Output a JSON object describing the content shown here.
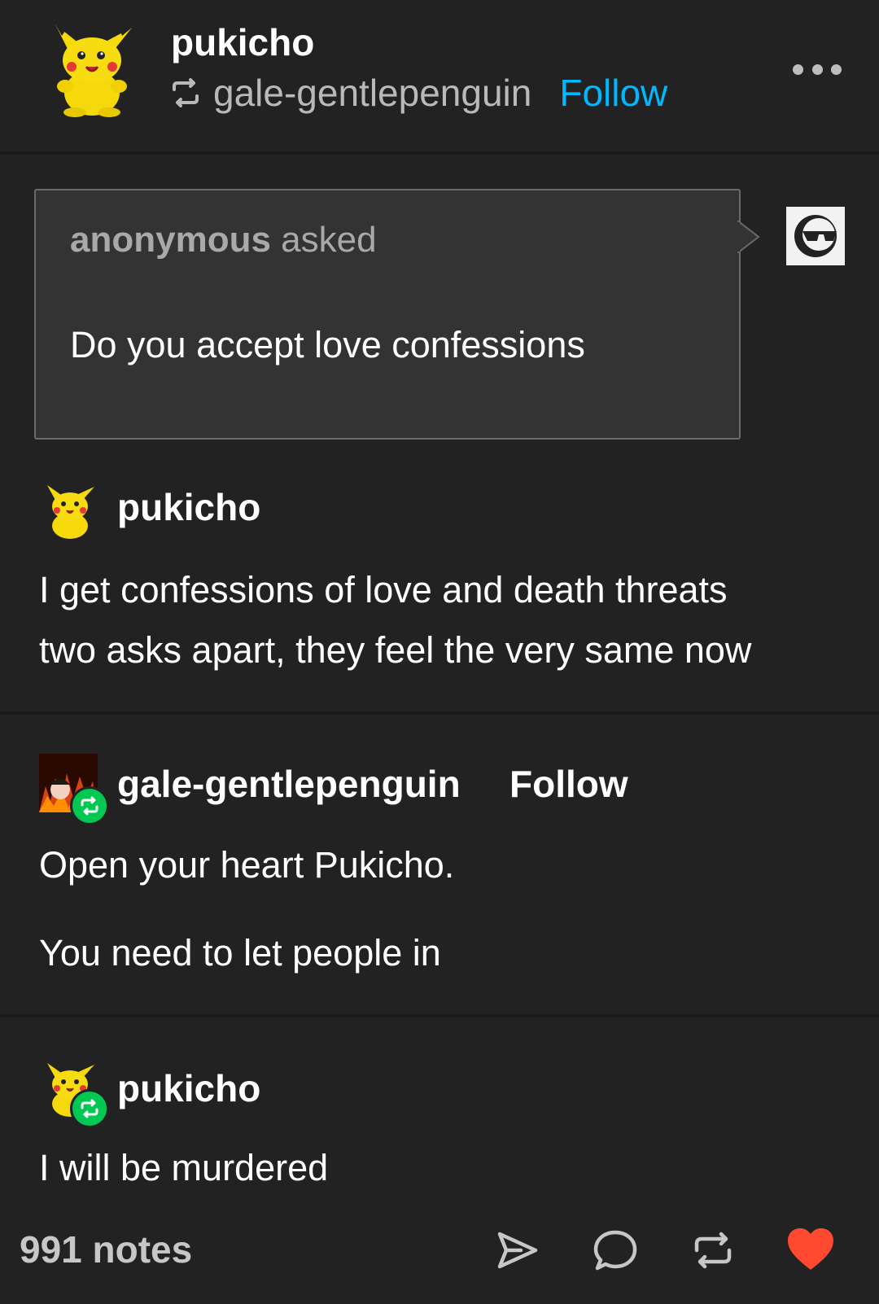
{
  "header": {
    "blog_name": "pukicho",
    "reblogged_from": "gale-gentlepenguin",
    "follow_label": "Follow"
  },
  "ask": {
    "asker": "anonymous",
    "asked_label": "asked",
    "question": "Do you accept love confessions"
  },
  "thread": [
    {
      "user": "pukicho",
      "lines": [
        "I get confessions of love and death threats",
        "two asks apart, they feel the very same now"
      ]
    },
    {
      "user": "gale-gentlepenguin",
      "follow_label": "Follow",
      "paragraphs": [
        "Open your heart Pukicho.",
        "You need to let people in"
      ]
    },
    {
      "user": "pukicho",
      "paragraphs": [
        "I will be murdered"
      ]
    }
  ],
  "footer": {
    "notes": "991 notes",
    "actions": [
      "send-icon",
      "reply-icon",
      "reblog-icon",
      "like-icon"
    ]
  },
  "colors": {
    "background": "#222222",
    "accent_blue": "#00b8ff",
    "reblog_green": "#00c853",
    "like_red": "#ff4930"
  }
}
